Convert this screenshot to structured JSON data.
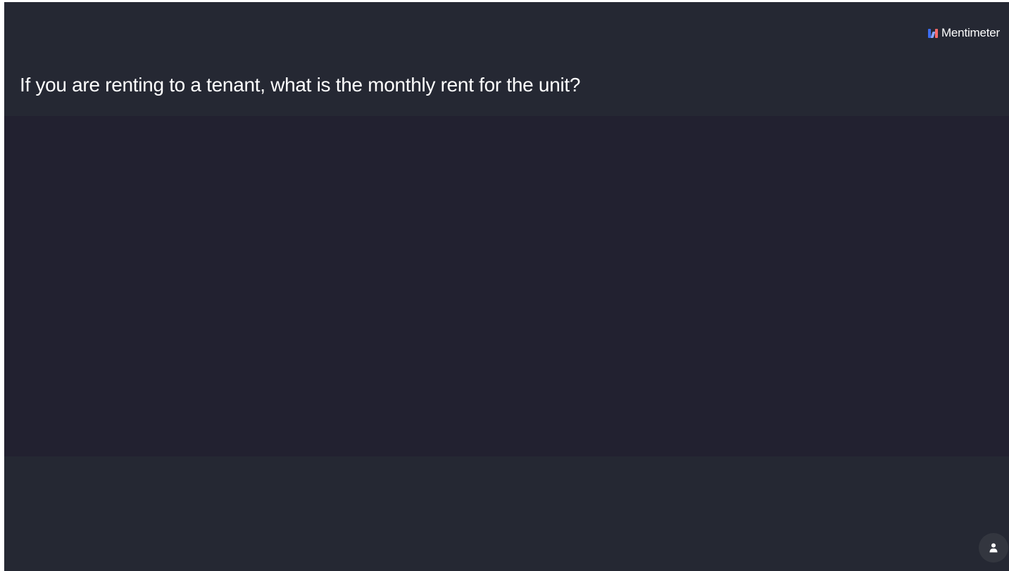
{
  "brand": {
    "name": "Mentimeter",
    "logo_icon": "mentimeter-logo-icon"
  },
  "slide": {
    "question": "If you are renting to a tenant, what is the monthly rent for the unit?"
  },
  "controls": {
    "participant_icon": "person-icon"
  },
  "colors": {
    "slide_background": "#252833",
    "canvas_background": "#222130",
    "text": "#ffffff",
    "logo_blue": "#3b6cf0",
    "logo_lightblue": "#8aa6ff",
    "logo_red": "#ff6a6a"
  }
}
